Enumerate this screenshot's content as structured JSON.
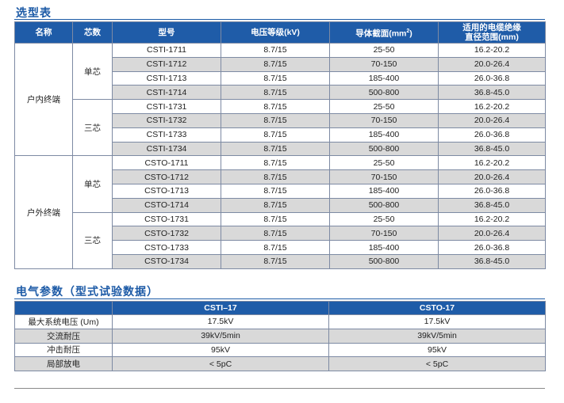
{
  "selection": {
    "title": "选型表",
    "headers": {
      "name": "名称",
      "cores": "芯数",
      "model": "型号",
      "voltage": "电压等级(kV)",
      "section_prefix": "导体截面(mm",
      "section_sup": "2",
      "section_suffix": ")",
      "diameter_line1": "适用的电缆绝缘",
      "diameter_line2": "直径范围(mm)"
    },
    "groups": [
      {
        "name": "户内终端",
        "core_groups": [
          {
            "cores": "单芯",
            "rows": [
              {
                "model": "CSTI-1711",
                "voltage": "8.7/15",
                "section": "25-50",
                "diameter": "16.2-20.2"
              },
              {
                "model": "CSTI-1712",
                "voltage": "8.7/15",
                "section": "70-150",
                "diameter": "20.0-26.4"
              },
              {
                "model": "CSTI-1713",
                "voltage": "8.7/15",
                "section": "185-400",
                "diameter": "26.0-36.8"
              },
              {
                "model": "CSTI-1714",
                "voltage": "8.7/15",
                "section": "500-800",
                "diameter": "36.8-45.0"
              }
            ]
          },
          {
            "cores": "三芯",
            "rows": [
              {
                "model": "CSTI-1731",
                "voltage": "8.7/15",
                "section": "25-50",
                "diameter": "16.2-20.2"
              },
              {
                "model": "CSTI-1732",
                "voltage": "8.7/15",
                "section": "70-150",
                "diameter": "20.0-26.4"
              },
              {
                "model": "CSTI-1733",
                "voltage": "8.7/15",
                "section": "185-400",
                "diameter": "26.0-36.8"
              },
              {
                "model": "CSTI-1734",
                "voltage": "8.7/15",
                "section": "500-800",
                "diameter": "36.8-45.0"
              }
            ]
          }
        ]
      },
      {
        "name": "户外终端",
        "core_groups": [
          {
            "cores": "单芯",
            "rows": [
              {
                "model": "CSTO-1711",
                "voltage": "8.7/15",
                "section": "25-50",
                "diameter": "16.2-20.2"
              },
              {
                "model": "CSTO-1712",
                "voltage": "8.7/15",
                "section": "70-150",
                "diameter": "20.0-26.4"
              },
              {
                "model": "CSTO-1713",
                "voltage": "8.7/15",
                "section": "185-400",
                "diameter": "26.0-36.8"
              },
              {
                "model": "CSTO-1714",
                "voltage": "8.7/15",
                "section": "500-800",
                "diameter": "36.8-45.0"
              }
            ]
          },
          {
            "cores": "三芯",
            "rows": [
              {
                "model": "CSTO-1731",
                "voltage": "8.7/15",
                "section": "25-50",
                "diameter": "16.2-20.2"
              },
              {
                "model": "CSTO-1732",
                "voltage": "8.7/15",
                "section": "70-150",
                "diameter": "20.0-26.4"
              },
              {
                "model": "CSTO-1733",
                "voltage": "8.7/15",
                "section": "185-400",
                "diameter": "26.0-36.8"
              },
              {
                "model": "CSTO-1734",
                "voltage": "8.7/15",
                "section": "500-800",
                "diameter": "36.8-45.0"
              }
            ]
          }
        ]
      }
    ]
  },
  "electrical": {
    "title": "电气参数（型式试验数据）",
    "headers": [
      "",
      "CSTI–17",
      "CSTO-17"
    ],
    "rows": [
      {
        "label": "最大系统电压 (Um)",
        "csti": "17.5kV",
        "csto": "17.5kV"
      },
      {
        "label": "交流耐压",
        "csti": "39kV/5min",
        "csto": "39kV/5min"
      },
      {
        "label": "冲击耐压",
        "csti": "95kV",
        "csto": "95kV"
      },
      {
        "label": "局部放电",
        "csti": "< 5pC",
        "csto": "< 5pC"
      }
    ]
  }
}
